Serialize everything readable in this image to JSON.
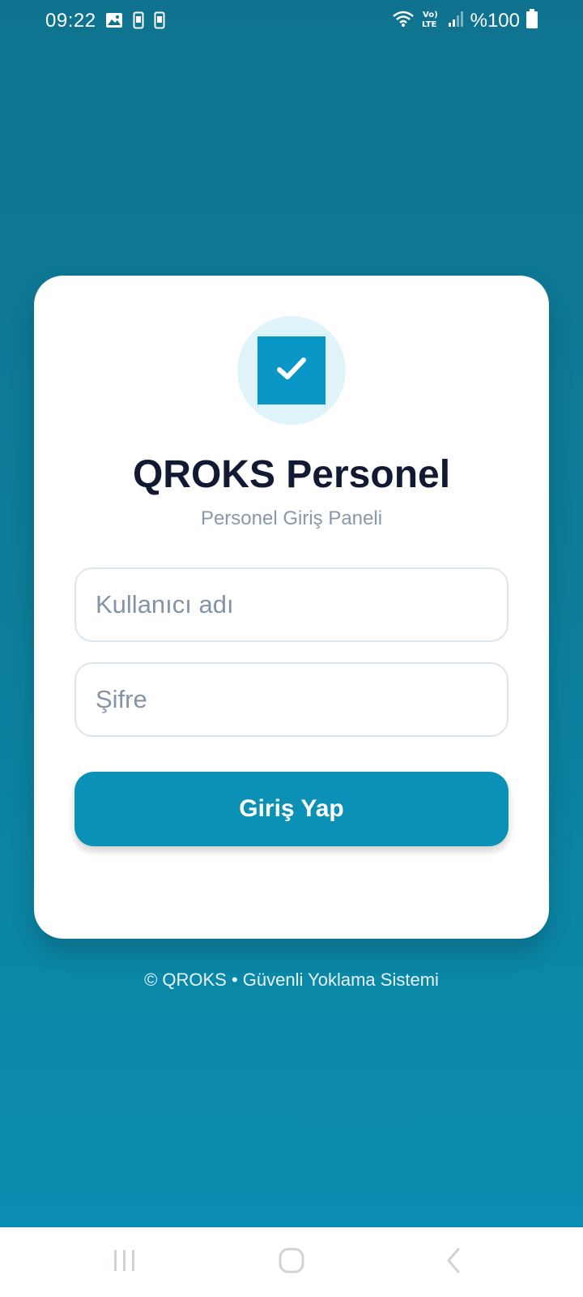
{
  "status_bar": {
    "time": "09:22",
    "battery": "%100",
    "icons": [
      "image-icon",
      "phone-sim-icon",
      "phone-sim-icon",
      "wifi-icon",
      "volte-lte-icon",
      "signal-icon",
      "battery-icon"
    ]
  },
  "card": {
    "logo_icon": "check-icon",
    "title": "QROKS Personel",
    "subtitle": "Personel Giriş Paneli"
  },
  "form": {
    "username_placeholder": "Kullanıcı adı",
    "password_placeholder": "Şifre",
    "submit_label": "Giriş Yap"
  },
  "footer": {
    "text": "© QROKS • Güvenli Yoklama Sistemi"
  },
  "nav_bar": {
    "icons": [
      "recent-apps-icon",
      "home-icon",
      "back-icon"
    ]
  },
  "colors": {
    "background_top": "#0f7390",
    "background_bottom": "#0a8fb3",
    "accent": "#0b96c8",
    "button": "#0b90b6",
    "title": "#121a33"
  }
}
